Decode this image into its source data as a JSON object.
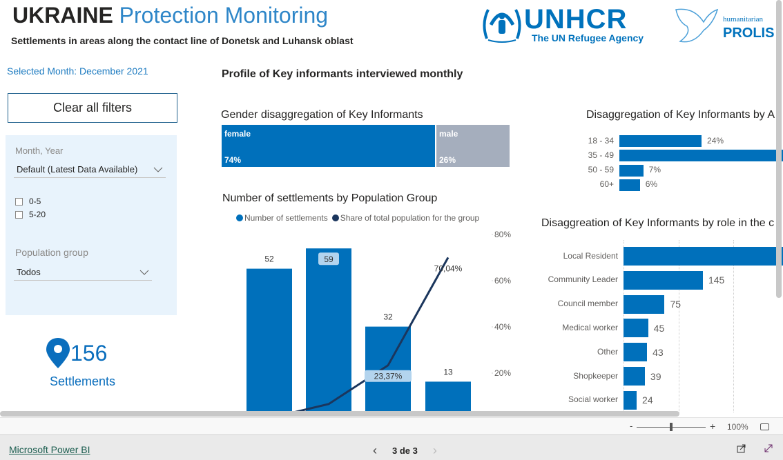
{
  "header": {
    "title_bold": "UKRAINE",
    "title_rest": "Protection Monitoring",
    "subtitle": "Settlements in areas along the contact line of Donetsk and Luhansk oblast",
    "logos": {
      "unhcr": "UNHCR",
      "unhcr_tagline": "The UN Refugee Agency",
      "prolis_small": "humanitarian",
      "prolis": "PROLIS"
    }
  },
  "sidebar": {
    "selected_month": "Selected Month: December 2021",
    "clear_filters": "Clear all filters",
    "filters": {
      "month_label": "Month, Year",
      "month_value": "Default (Latest Data Available)",
      "checkbox_options": [
        "0-5",
        "5-20"
      ],
      "population_label": "Population group",
      "population_value": "Todos"
    },
    "kpi": {
      "value": "156",
      "label": "Settlements",
      "icon": "map-pin-icon"
    }
  },
  "main": {
    "section_title": "Profile of Key informants interviewed monthly"
  },
  "colors": {
    "primary": "#0070bb",
    "male": "#a5aebd",
    "line": "#1b365d",
    "label_bg": "#b3d4ee"
  },
  "chart_data": [
    {
      "type": "bar",
      "title": "Gender disaggregation of Key Informants",
      "orientation": "stacked-horizontal",
      "categories": [
        "female",
        "male"
      ],
      "values": [
        74,
        26
      ],
      "labels": [
        "74%",
        "26%"
      ]
    },
    {
      "type": "bar",
      "title": "Number of settlements by Population Group",
      "legend": [
        "Number of settlements",
        "Share of total population for the group"
      ],
      "legend_position": "top",
      "series": [
        {
          "name": "Number of settlements",
          "type": "bar",
          "values": [
            52,
            59,
            32,
            13
          ],
          "labels": [
            "52",
            "59",
            "32",
            "13"
          ]
        },
        {
          "name": "Share of total population for the group",
          "type": "line",
          "values": [
            0.5,
            6.6,
            23.37,
            70.04
          ],
          "labels": [
            "",
            "",
            "23,37%",
            "70,04%"
          ]
        }
      ],
      "y2_ticks": [
        "20%",
        "40%",
        "60%",
        "80%"
      ],
      "y2lim": [
        0,
        80
      ]
    },
    {
      "type": "bar",
      "title": "Disaggregation of Key Informants by A",
      "orientation": "horizontal",
      "categories": [
        "18 - 34",
        "35 - 49",
        "50 - 59",
        "60+"
      ],
      "values": [
        24,
        63,
        7,
        6
      ],
      "labels": [
        "24%",
        "",
        "7%",
        "6%"
      ]
    },
    {
      "type": "bar",
      "title": "Disaggreation of Key Informants by role in the c",
      "orientation": "horizontal",
      "categories": [
        "Local Resident",
        "Community Leader",
        "Council member",
        "Medical worker",
        "Other",
        "Shopkeeper",
        "Social worker"
      ],
      "values": [
        null,
        145,
        75,
        45,
        43,
        39,
        24
      ],
      "labels": [
        "",
        "145",
        "75",
        "45",
        "43",
        "39",
        "24"
      ]
    }
  ],
  "zoom": {
    "minus": "-",
    "plus": "+",
    "level": "100%",
    "slider_percent": 50
  },
  "footer": {
    "brand": "Microsoft Power BI",
    "page": "3 de 3",
    "prev": "‹",
    "next": "›"
  }
}
